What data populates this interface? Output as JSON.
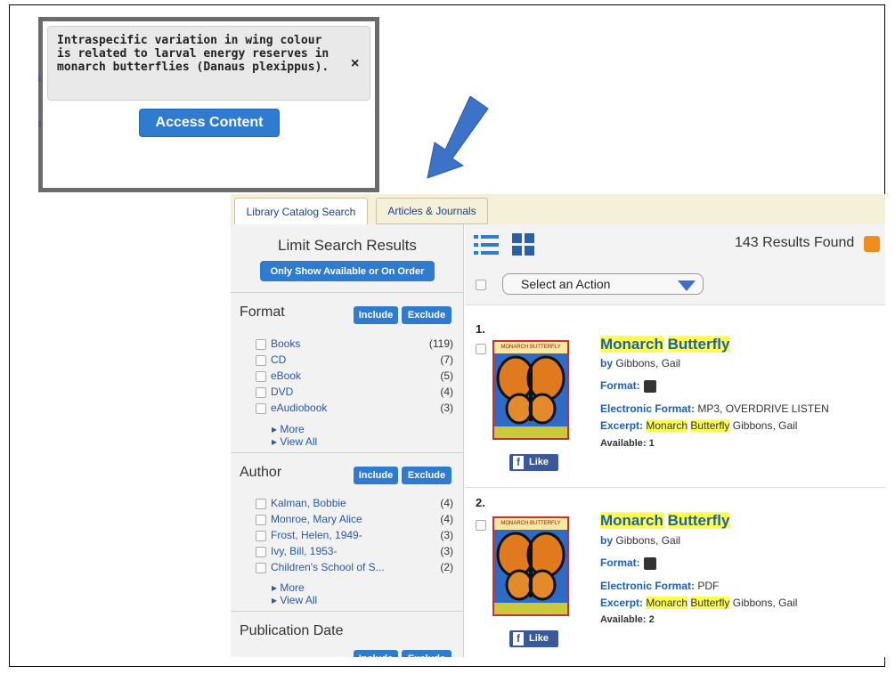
{
  "popup": {
    "title": "Intraspecific variation in wing colour is related to larval energy reserves in monarch butterflies (Danaus plexippus).",
    "close": "×",
    "access_button": "Access Content"
  },
  "tabs": [
    "Library Catalog Search",
    "Articles & Journals"
  ],
  "sidebar": {
    "title": "Limit Search Results",
    "show_available": "Only Show Available or On Order",
    "include": "Include",
    "exclude": "Exclude",
    "format": {
      "title": "Format",
      "items": [
        {
          "label": "Books",
          "count": "(119)"
        },
        {
          "label": "CD",
          "count": "(7)"
        },
        {
          "label": "eBook",
          "count": "(5)"
        },
        {
          "label": "DVD",
          "count": "(4)"
        },
        {
          "label": "eAudiobook",
          "count": "(3)"
        }
      ],
      "more": "▸ More",
      "view_all": "▸ View All"
    },
    "author": {
      "title": "Author",
      "items": [
        {
          "label": "Kalman, Bobbie",
          "count": "(4)"
        },
        {
          "label": "Monroe, Mary Alice",
          "count": "(4)"
        },
        {
          "label": "Frost, Helen, 1949-",
          "count": "(3)"
        },
        {
          "label": "Ivy, Bill, 1953-",
          "count": "(3)"
        },
        {
          "label": "Children's School of S...",
          "count": "(2)"
        }
      ],
      "more": "▸ More",
      "view_all": "▸ View All"
    },
    "pubdate": {
      "title": "Publication Date"
    }
  },
  "results": {
    "count_text": "143 Results Found",
    "select_action": "Select an Action",
    "records": [
      {
        "num": "1.",
        "title_a": "Monarch",
        "title_b": "Butterfly",
        "by_label": "by",
        "author": "Gibbons, Gail",
        "format_label": "Format:",
        "eformat_label": "Electronic Format:",
        "eformat_value": "MP3, OVERDRIVE LISTEN",
        "excerpt_label": "Excerpt:",
        "excerpt_a": "Monarch",
        "excerpt_b": "Butterfly",
        "excerpt_rest": "Gibbons, Gail",
        "available": "Available: 1",
        "like": "Like",
        "cover_band": "MONARCH BUTTERFLY"
      },
      {
        "num": "2.",
        "title_a": "Monarch",
        "title_b": "Butterfly",
        "by_label": "by",
        "author": "Gibbons, Gail",
        "format_label": "Format:",
        "eformat_label": "Electronic Format:",
        "eformat_value": "PDF",
        "excerpt_label": "Excerpt:",
        "excerpt_a": "Monarch",
        "excerpt_b": "Butterfly",
        "excerpt_rest": "Gibbons, Gail",
        "available": "Available: 2",
        "like": "Like",
        "cover_band": "MONARCH BUTTERFLY"
      }
    ]
  },
  "colors": {
    "accent": "#2f7bd0",
    "highlight": "#ffff4d",
    "arrow": "#3d72c9"
  },
  "icons": [
    "close-icon",
    "arrow-icon",
    "list-view-icon",
    "grid-view-icon",
    "rss-icon",
    "headphones-icon",
    "download-icon",
    "facebook-icon"
  ]
}
